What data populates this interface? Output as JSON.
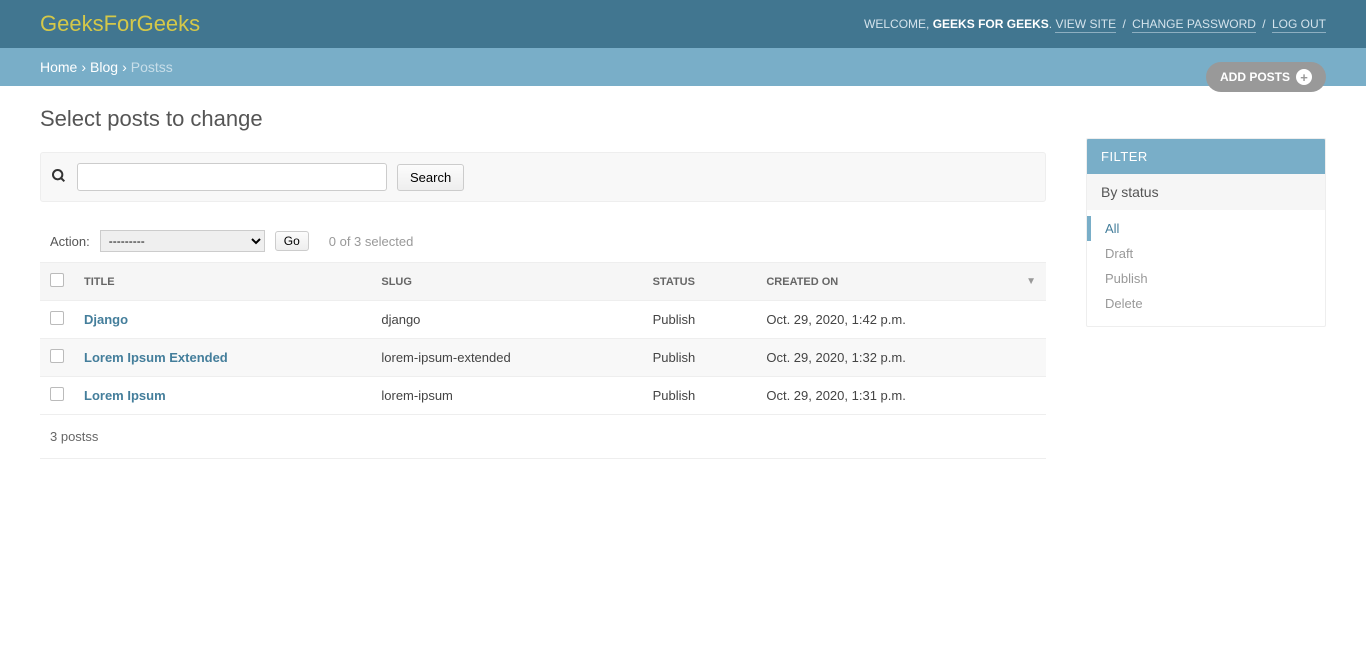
{
  "header": {
    "brand": "GeeksForGeeks",
    "welcome_prefix": "WELCOME,",
    "username": "GEEKS FOR GEEKS",
    "view_site": "VIEW SITE",
    "change_password": "CHANGE PASSWORD",
    "logout": "LOG OUT"
  },
  "breadcrumbs": {
    "home": "Home",
    "app": "Blog",
    "current": "Postss"
  },
  "page": {
    "title": "Select posts to change",
    "add_button": "ADD POSTS",
    "search_button": "Search",
    "action_label": "Action:",
    "action_placeholder": "---------",
    "go": "Go",
    "selection_note": "0 of 3 selected",
    "paginator": "3 postss"
  },
  "table": {
    "headers": {
      "title": "TITLE",
      "slug": "SLUG",
      "status": "STATUS",
      "created": "CREATED ON"
    },
    "rows": [
      {
        "title": "Django",
        "slug": "django",
        "status": "Publish",
        "created": "Oct. 29, 2020, 1:42 p.m."
      },
      {
        "title": "Lorem Ipsum Extended",
        "slug": "lorem-ipsum-extended",
        "status": "Publish",
        "created": "Oct. 29, 2020, 1:32 p.m."
      },
      {
        "title": "Lorem Ipsum",
        "slug": "lorem-ipsum",
        "status": "Publish",
        "created": "Oct. 29, 2020, 1:31 p.m."
      }
    ]
  },
  "filter": {
    "title": "FILTER",
    "section": "By status",
    "options": [
      "All",
      "Draft",
      "Publish",
      "Delete"
    ],
    "selected_index": 0
  }
}
